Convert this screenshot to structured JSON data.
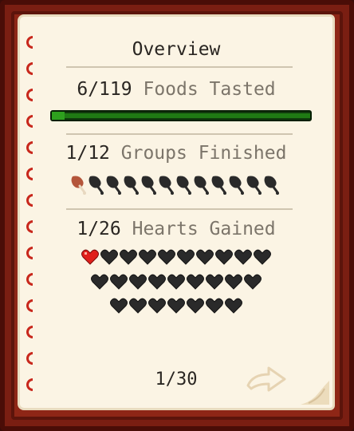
{
  "title": "Overview",
  "foods": {
    "count": "6/119",
    "label": "Foods Tasted",
    "progress": 0.05
  },
  "groups": {
    "count": "1/12",
    "label": "Groups Finished",
    "finished": 1,
    "total": 12
  },
  "hearts": {
    "count": "1/26",
    "label": "Hearts Gained",
    "gained": 1,
    "rows": [
      10,
      9,
      7
    ]
  },
  "page_indicator": "1/30",
  "colors": {
    "page": "#fbf4e4",
    "frame": "#7a1e12",
    "progress_fill": "#2ea01e",
    "heart_filled": "#e0201b",
    "icon_empty": "#2a2a2a",
    "drumstick_filled": "#b4553a",
    "label_gray": "#7c756a"
  },
  "icons": {
    "group_icon": "drumstick-icon",
    "heart_icon": "heart-icon",
    "next_icon": "next-page-arrow-icon"
  }
}
